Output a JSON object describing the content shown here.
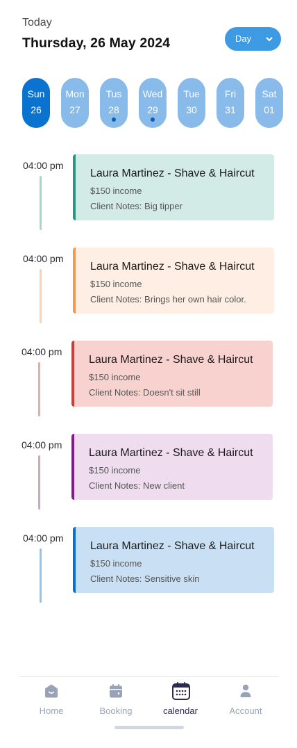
{
  "header": {
    "today_label": "Today",
    "date": "Thursday, 26 May 2024",
    "view_select": {
      "value": "Day"
    }
  },
  "days": [
    {
      "name": "Sun",
      "num": "26",
      "active": true,
      "dot": false
    },
    {
      "name": "Mon",
      "num": "27",
      "active": false,
      "dot": false
    },
    {
      "name": "Tus",
      "num": "28",
      "active": false,
      "dot": true
    },
    {
      "name": "Wed",
      "num": "29",
      "active": false,
      "dot": true
    },
    {
      "name": "Tue",
      "num": "30",
      "active": false,
      "dot": false
    },
    {
      "name": "Fri",
      "num": "31",
      "active": false,
      "dot": false
    },
    {
      "name": "Sat",
      "num": "01",
      "active": false,
      "dot": false
    }
  ],
  "events": [
    {
      "time": "04:00 pm",
      "title": "Laura Martinez - Shave & Haircut",
      "income": "$150 income",
      "notes": "Client Notes: Big tipper",
      "accent": "#2a9585",
      "bg": "#d2ebe6",
      "line": "#a5d6ce"
    },
    {
      "time": "04:00 pm",
      "title": "Laura Martinez - Shave & Haircut",
      "income": "$150 income",
      "notes": "Client Notes: Brings her own hair color.",
      "accent": "#ef9a57",
      "bg": "#feeee3",
      "line": "#f6d3b5"
    },
    {
      "time": "04:00 pm",
      "title": "Laura Martinez - Shave & Haircut",
      "income": "$150 income",
      "notes": "Client Notes: Doesn't sit still",
      "accent": "#d13a34",
      "bg": "#f7d2cf",
      "line": "#edaaa6"
    },
    {
      "time": "04:00 pm",
      "title": "Laura Martinez - Shave & Haircut",
      "income": "$150 income",
      "notes": "Client Notes: New client",
      "accent": "#8a1592",
      "bg": "#efdcef",
      "line": "#d4a3d5"
    },
    {
      "time": "04:00 pm",
      "title": "Laura Martinez - Shave & Haircut",
      "income": "$150 income",
      "notes": "Client Notes: Sensitive skin",
      "accent": "#0a70c6",
      "bg": "#c9e0f4",
      "line": "#94c3ec"
    }
  ],
  "nav": [
    {
      "label": "Home",
      "icon": "home-icon",
      "active": false
    },
    {
      "label": "Booking",
      "icon": "booking-icon",
      "active": false
    },
    {
      "label": "calendar",
      "icon": "calendar-icon",
      "active": true
    },
    {
      "label": "Account",
      "icon": "account-icon",
      "active": false
    }
  ],
  "colors": {
    "primary": "#0a73cf",
    "day_inactive": "#88bbea",
    "select_bg": "#3e9ae3",
    "nav_inactive": "#9aa3b5",
    "nav_active": "#2c2c52"
  }
}
